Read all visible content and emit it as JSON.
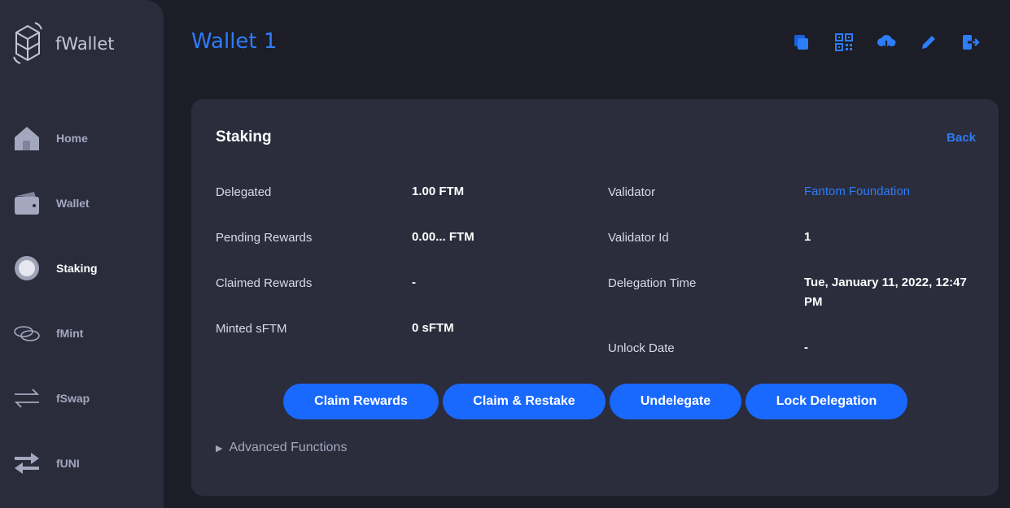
{
  "app": {
    "name": "fWallet",
    "page_title": "Wallet 1"
  },
  "sidebar": {
    "items": [
      {
        "label": "Home",
        "icon": "home-icon"
      },
      {
        "label": "Wallet",
        "icon": "wallet-icon"
      },
      {
        "label": "Staking",
        "icon": "staking-icon",
        "active": true
      },
      {
        "label": "fMint",
        "icon": "coins-icon"
      },
      {
        "label": "fSwap",
        "icon": "swap-icon"
      },
      {
        "label": "fUNI",
        "icon": "exchange-arrows-icon"
      }
    ]
  },
  "header_icons": [
    "copy-icon",
    "qr-code-icon",
    "cloud-download-icon",
    "edit-pencil-icon",
    "logout-icon"
  ],
  "staking": {
    "title": "Staking",
    "back_label": "Back",
    "delegated_label": "Delegated",
    "delegated_value": "1.00 FTM",
    "pending_rewards_label": "Pending Rewards",
    "pending_rewards_value": "0.00... FTM",
    "claimed_rewards_label": "Claimed Rewards",
    "claimed_rewards_value": "-",
    "minted_sftm_label": "Minted sFTM",
    "minted_sftm_value": "0 sFTM",
    "validator_label": "Validator",
    "validator_value": "Fantom Foundation",
    "validator_id_label": "Validator Id",
    "validator_id_value": "1",
    "delegation_time_label": "Delegation Time",
    "delegation_time_value": "Tue, January 11, 2022, 12:47 PM",
    "unlock_date_label": "Unlock Date",
    "unlock_date_value": "-"
  },
  "actions": {
    "claim_rewards": "Claim Rewards",
    "claim_restake": "Claim & Restake",
    "undelegate": "Undelegate",
    "lock_delegation": "Lock Delegation"
  },
  "advanced_label": "Advanced Functions",
  "colors": {
    "accent": "#1969ff",
    "link": "#2d7df8",
    "background": "#1c1d27",
    "panel": "#2b2c3c"
  }
}
